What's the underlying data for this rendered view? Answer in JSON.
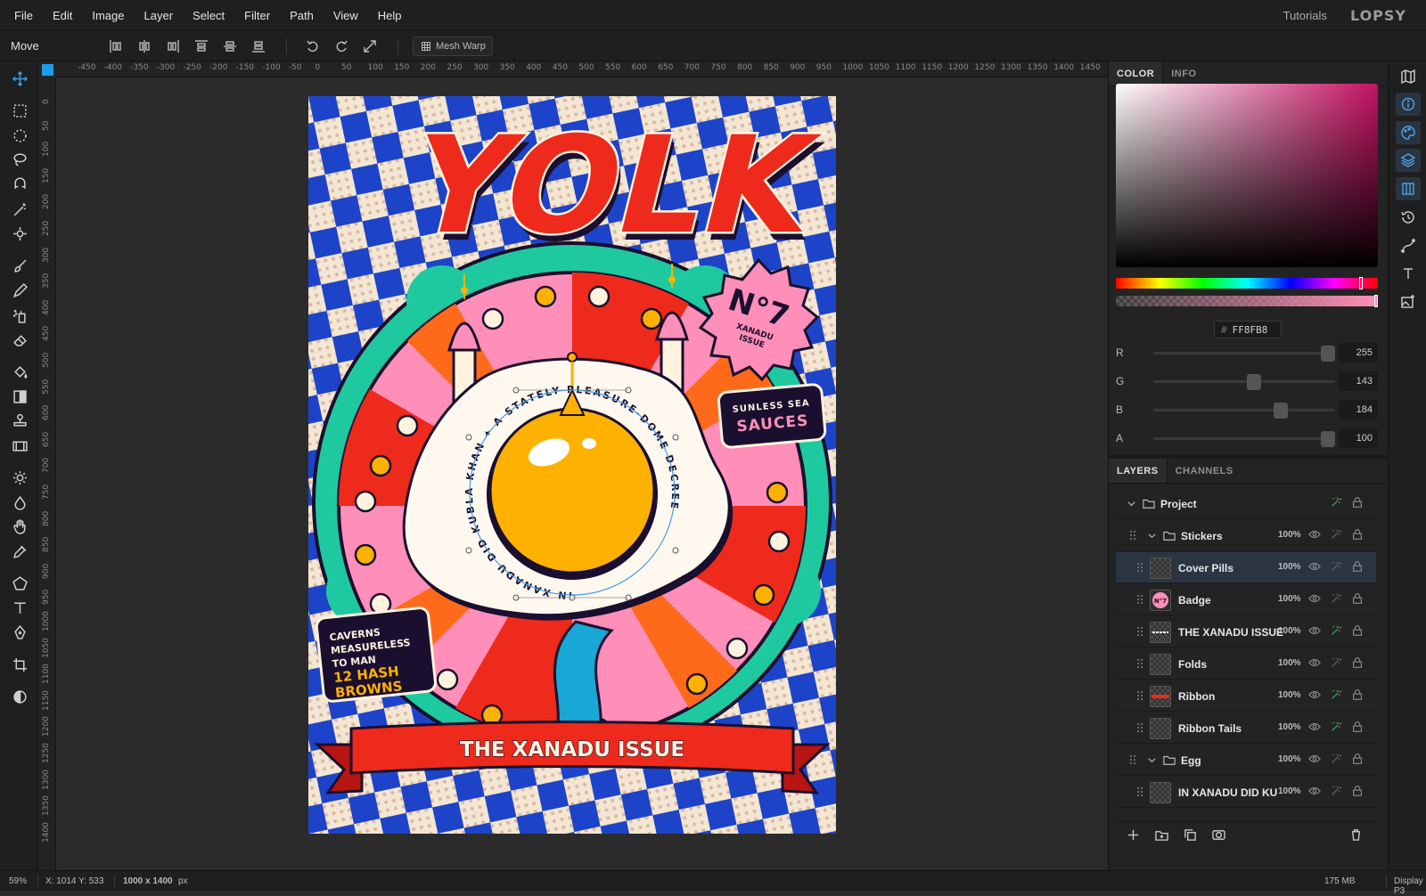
{
  "menu": [
    "File",
    "Edit",
    "Image",
    "Layer",
    "Select",
    "Filter",
    "Path",
    "View",
    "Help"
  ],
  "menu_right": {
    "tutorials": "Tutorials",
    "logo": "LOPSY"
  },
  "options": {
    "tool": "Move",
    "mesh_warp": "Mesh Warp"
  },
  "ruler": {
    "h": [
      "-450",
      "-400",
      "-350",
      "-300",
      "-250",
      "-200",
      "-150",
      "-100",
      "-50",
      "0",
      "50",
      "100",
      "150",
      "200",
      "250",
      "300",
      "350",
      "400",
      "450",
      "500",
      "550",
      "600",
      "650",
      "700",
      "750",
      "800",
      "850",
      "900",
      "950",
      "1000",
      "1050",
      "1100",
      "1150",
      "1200",
      "1250",
      "1300",
      "1350",
      "1400",
      "1450"
    ],
    "v": [
      "0",
      "50",
      "100",
      "150",
      "200",
      "250",
      "300",
      "350",
      "400",
      "450",
      "500",
      "550",
      "600",
      "650",
      "700",
      "750",
      "800",
      "850",
      "900",
      "950",
      "1000",
      "1050",
      "1100",
      "1150",
      "1200",
      "1250",
      "1300",
      "1350",
      "1400"
    ]
  },
  "poster": {
    "title": "YOLK",
    "badge_no": "N°7",
    "badge_sub1": "XANADU",
    "badge_sub2": "ISSUE",
    "sticker1_a": "SUNLESS SEA",
    "sticker1_b": "SAUCES",
    "sticker2_a": "CAVERNS",
    "sticker2_b": "MEASURELESS",
    "sticker2_c": "TO MAN",
    "sticker2_d": "12 HASH",
    "sticker2_e": "BROWNS",
    "ring_text": "IN XANADU DID KUBLA KHAN ✦ A STATELY PLEASURE-DOME DECREE",
    "ribbon": "THE XANADU ISSUE"
  },
  "color_panel": {
    "tabs": [
      "COLOR",
      "INFO"
    ],
    "hex_prefix": "#",
    "hex": "FF8FB8",
    "hue_fraction": 0.94,
    "channels": [
      {
        "label": "R",
        "value": "255",
        "fraction": 1.0
      },
      {
        "label": "G",
        "value": "143",
        "fraction": 0.56
      },
      {
        "label": "B",
        "value": "184",
        "fraction": 0.72
      },
      {
        "label": "A",
        "value": "100",
        "fraction": 1.0
      }
    ]
  },
  "layers_panel": {
    "tabs": [
      "LAYERS",
      "CHANNELS"
    ],
    "rows": [
      {
        "name": "Project",
        "type": "group",
        "opacity": "",
        "fx": true
      },
      {
        "name": "Stickers",
        "type": "group",
        "opacity": "100%",
        "fx": false
      },
      {
        "name": "Cover Pills",
        "type": "layer",
        "opacity": "100%",
        "fx": false,
        "selected": true
      },
      {
        "name": "Badge",
        "type": "layer",
        "opacity": "100%",
        "fx": false
      },
      {
        "name": "THE XANADU ISSUE",
        "type": "layer",
        "opacity": "100%",
        "fx": true
      },
      {
        "name": "Folds",
        "type": "layer",
        "opacity": "100%",
        "fx": false
      },
      {
        "name": "Ribbon",
        "type": "layer",
        "opacity": "100%",
        "fx": true
      },
      {
        "name": "Ribbon Tails",
        "type": "layer",
        "opacity": "100%",
        "fx": true
      },
      {
        "name": "Egg",
        "type": "group",
        "opacity": "100%",
        "fx": false
      },
      {
        "name": "IN XANADU DID KU",
        "type": "layer",
        "opacity": "100%",
        "fx": false
      }
    ]
  },
  "status": {
    "zoom": "59%",
    "cursor": "X: 1014  Y: 533",
    "doc_size_value": "1000 x 1400",
    "doc_size_unit": "px",
    "memory": "175 MB",
    "profile": "Display P3"
  },
  "colors": {
    "accent": "#3e9fe8",
    "fx_on": "#4caf50",
    "poster_red": "#ee2a1c",
    "poster_blue": "#1d44c8",
    "poster_teal": "#1fc9a0",
    "poster_pink": "#ff8fb8",
    "yolk": "#ffb100"
  }
}
